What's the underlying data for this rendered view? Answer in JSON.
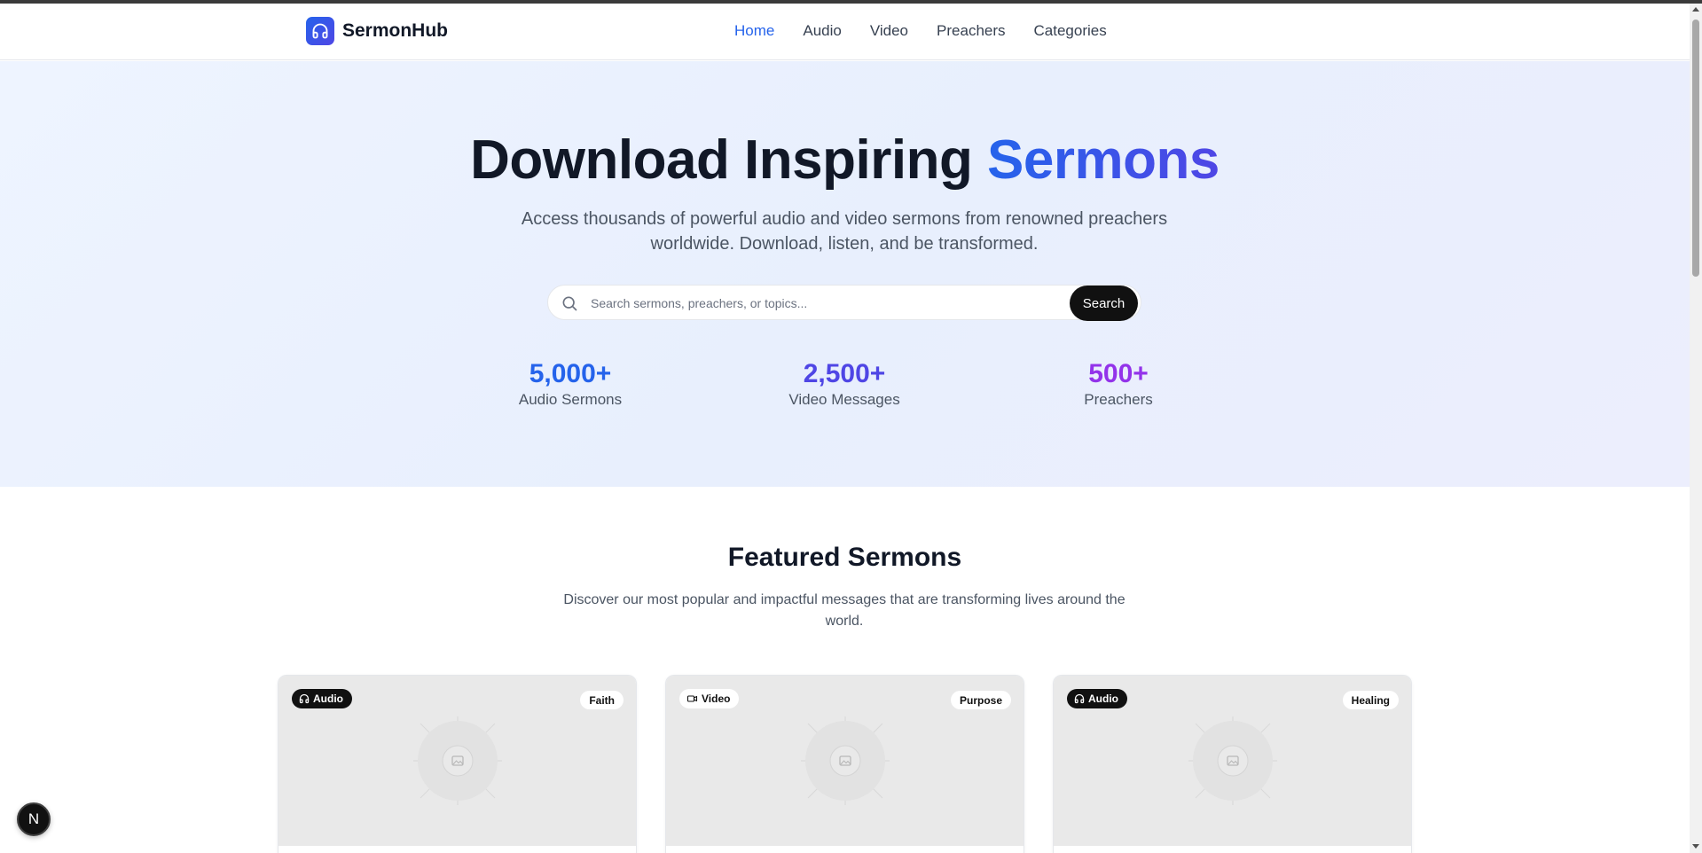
{
  "brand": {
    "name": "SermonHub",
    "logo_icon": "headphones-icon",
    "accent_color": "#2563eb"
  },
  "nav": {
    "items": [
      {
        "label": "Home",
        "active": true
      },
      {
        "label": "Audio",
        "active": false
      },
      {
        "label": "Video",
        "active": false
      },
      {
        "label": "Preachers",
        "active": false
      },
      {
        "label": "Categories",
        "active": false
      }
    ]
  },
  "hero": {
    "title_main": "Download Inspiring ",
    "title_accent": "Sermons",
    "subtitle": "Access thousands of powerful audio and video sermons from renowned preachers worldwide. Download, listen, and be transformed."
  },
  "search": {
    "placeholder": "Search sermons, preachers, or topics...",
    "value": "",
    "button_label": "Search"
  },
  "stats": [
    {
      "value": "5,000+",
      "label": "Audio Sermons",
      "color": "#2563eb"
    },
    {
      "value": "2,500+",
      "label": "Video Messages",
      "color": "#4f46e5"
    },
    {
      "value": "500+",
      "label": "Preachers",
      "color": "#9333ea"
    }
  ],
  "featured": {
    "title": "Featured Sermons",
    "subtitle": "Discover our most popular and impactful messages that are transforming lives around the world."
  },
  "cards": [
    {
      "media_type": "Audio",
      "media_icon": "headphones-icon",
      "category": "Faith"
    },
    {
      "media_type": "Video",
      "media_icon": "video-camera-icon",
      "category": "Purpose"
    },
    {
      "media_type": "Audio",
      "media_icon": "headphones-icon",
      "category": "Healing"
    }
  ],
  "dev_badge": {
    "label": "N"
  }
}
